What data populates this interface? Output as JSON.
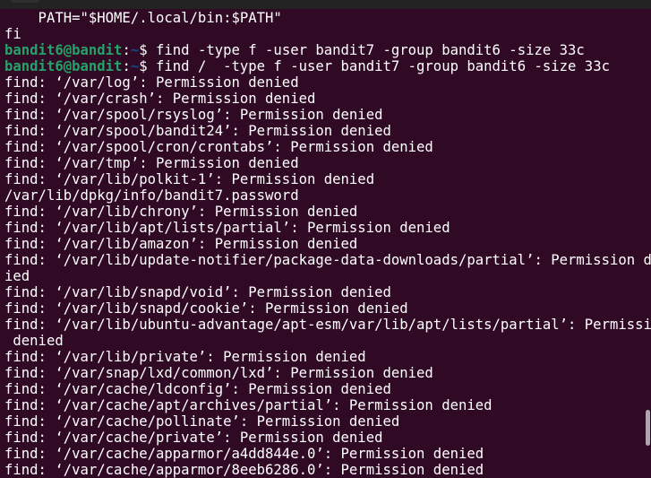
{
  "colors": {
    "background": "#300a24",
    "prompt_user": "#26a269",
    "prompt_path": "#12488b",
    "text": "#ffffff"
  },
  "prompt": {
    "user_host": "bandit6@bandit",
    "colon": ":",
    "path": "~",
    "symbol": "$ "
  },
  "lines": [
    {
      "type": "text",
      "text": "    PATH=\"$HOME/.local/bin:$PATH\""
    },
    {
      "type": "text",
      "text": "fi"
    },
    {
      "type": "prompt",
      "command": "find -type f -user bandit7 -group bandit6 -size 33c"
    },
    {
      "type": "prompt",
      "command": "find /  -type f -user bandit7 -group bandit6 -size 33c"
    },
    {
      "type": "text",
      "text": "find: ‘/var/log’: Permission denied"
    },
    {
      "type": "text",
      "text": "find: ‘/var/crash’: Permission denied"
    },
    {
      "type": "text",
      "text": "find: ‘/var/spool/rsyslog’: Permission denied"
    },
    {
      "type": "text",
      "text": "find: ‘/var/spool/bandit24’: Permission denied"
    },
    {
      "type": "text",
      "text": "find: ‘/var/spool/cron/crontabs’: Permission denied"
    },
    {
      "type": "text",
      "text": "find: ‘/var/tmp’: Permission denied"
    },
    {
      "type": "text",
      "text": "find: ‘/var/lib/polkit-1’: Permission denied"
    },
    {
      "type": "text",
      "text": "/var/lib/dpkg/info/bandit7.password"
    },
    {
      "type": "text",
      "text": "find: ‘/var/lib/chrony’: Permission denied"
    },
    {
      "type": "text",
      "text": "find: ‘/var/lib/apt/lists/partial’: Permission denied"
    },
    {
      "type": "text",
      "text": "find: ‘/var/lib/amazon’: Permission denied"
    },
    {
      "type": "text",
      "text": "find: ‘/var/lib/update-notifier/package-data-downloads/partial’: Permission den"
    },
    {
      "type": "text",
      "text": "ied"
    },
    {
      "type": "text",
      "text": "find: ‘/var/lib/snapd/void’: Permission denied"
    },
    {
      "type": "text",
      "text": "find: ‘/var/lib/snapd/cookie’: Permission denied"
    },
    {
      "type": "text",
      "text": "find: ‘/var/lib/ubuntu-advantage/apt-esm/var/lib/apt/lists/partial’: Permission"
    },
    {
      "type": "text",
      "text": " denied"
    },
    {
      "type": "text",
      "text": "find: ‘/var/lib/private’: Permission denied"
    },
    {
      "type": "text",
      "text": "find: ‘/var/snap/lxd/common/lxd’: Permission denied"
    },
    {
      "type": "text",
      "text": "find: ‘/var/cache/ldconfig’: Permission denied"
    },
    {
      "type": "text",
      "text": "find: ‘/var/cache/apt/archives/partial’: Permission denied"
    },
    {
      "type": "text",
      "text": "find: ‘/var/cache/pollinate’: Permission denied"
    },
    {
      "type": "text",
      "text": "find: ‘/var/cache/private’: Permission denied"
    },
    {
      "type": "text",
      "text": "find: ‘/var/cache/apparmor/a4dd844e.0’: Permission denied"
    },
    {
      "type": "text",
      "text": "find: ‘/var/cache/apparmor/8eeb6286.0’: Permission denied"
    }
  ]
}
